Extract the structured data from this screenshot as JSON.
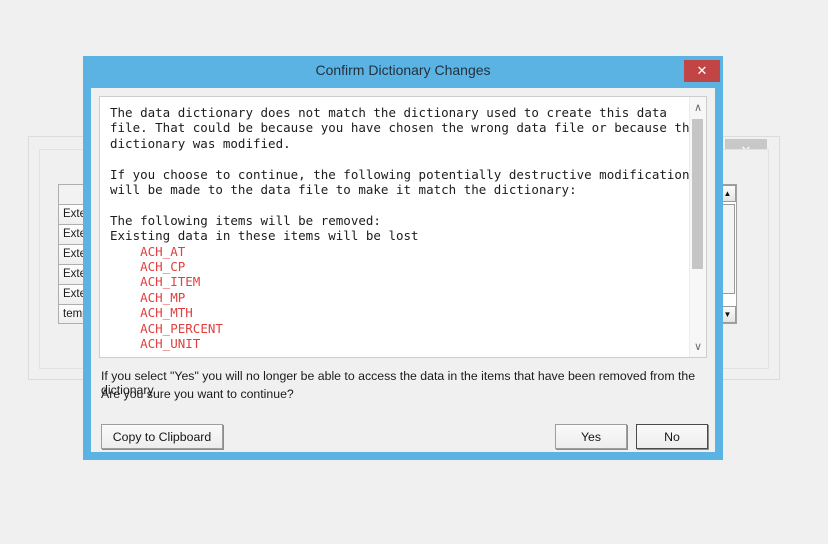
{
  "background_window": {
    "close_icon": "close-icon",
    "close_label": "✕",
    "fields": [
      {
        "label": ""
      },
      {
        "label": "Extern"
      },
      {
        "label": "Extern"
      },
      {
        "label": "Extern"
      },
      {
        "label": "Extern"
      },
      {
        "label": "Extern"
      },
      {
        "label": "tempF"
      }
    ],
    "combo_buttons": [
      {
        "label": ""
      },
      {
        "label": "▼"
      },
      {
        "label": "▼"
      },
      {
        "label": "▼"
      },
      {
        "label": "▼"
      },
      {
        "label": "▼"
      },
      {
        "label": "▼"
      }
    ],
    "scrollbar": {
      "up_label": "▲",
      "down_label": "▼"
    }
  },
  "dialog": {
    "title": "Confirm Dictionary Changes",
    "close_label": "✕",
    "titlebar_color": "#5bb3e4",
    "close_color": "#c14545",
    "message": {
      "paragraph1": "The data dictionary does not match the dictionary used to create this data\nfile. That could be because you have chosen the wrong data file or because the\ndictionary was modified.",
      "paragraph2": "If you choose to continue, the following potentially destructive modifications\nwill be made to the data file to make it match the dictionary:",
      "paragraph3_line1": "The following items will be removed:",
      "paragraph3_line2": "Existing data in these items will be lost",
      "removed_items": [
        "ACH_AT",
        "ACH_CP",
        "ACH_ITEM",
        "ACH_MP",
        "ACH_MTH",
        "ACH_PERCENT",
        "ACH_UNIT"
      ],
      "item_color": "#e04040"
    },
    "scrollbar": {
      "up_label": "∧",
      "down_label": "∨"
    },
    "warning_line1": "If you select \"Yes\" you will no longer be able to access the data in the items that have been removed from the dictionary.",
    "warning_line2": "Are you sure you want to continue?",
    "buttons": {
      "copy": "Copy to Clipboard",
      "yes": "Yes",
      "no": "No"
    }
  }
}
